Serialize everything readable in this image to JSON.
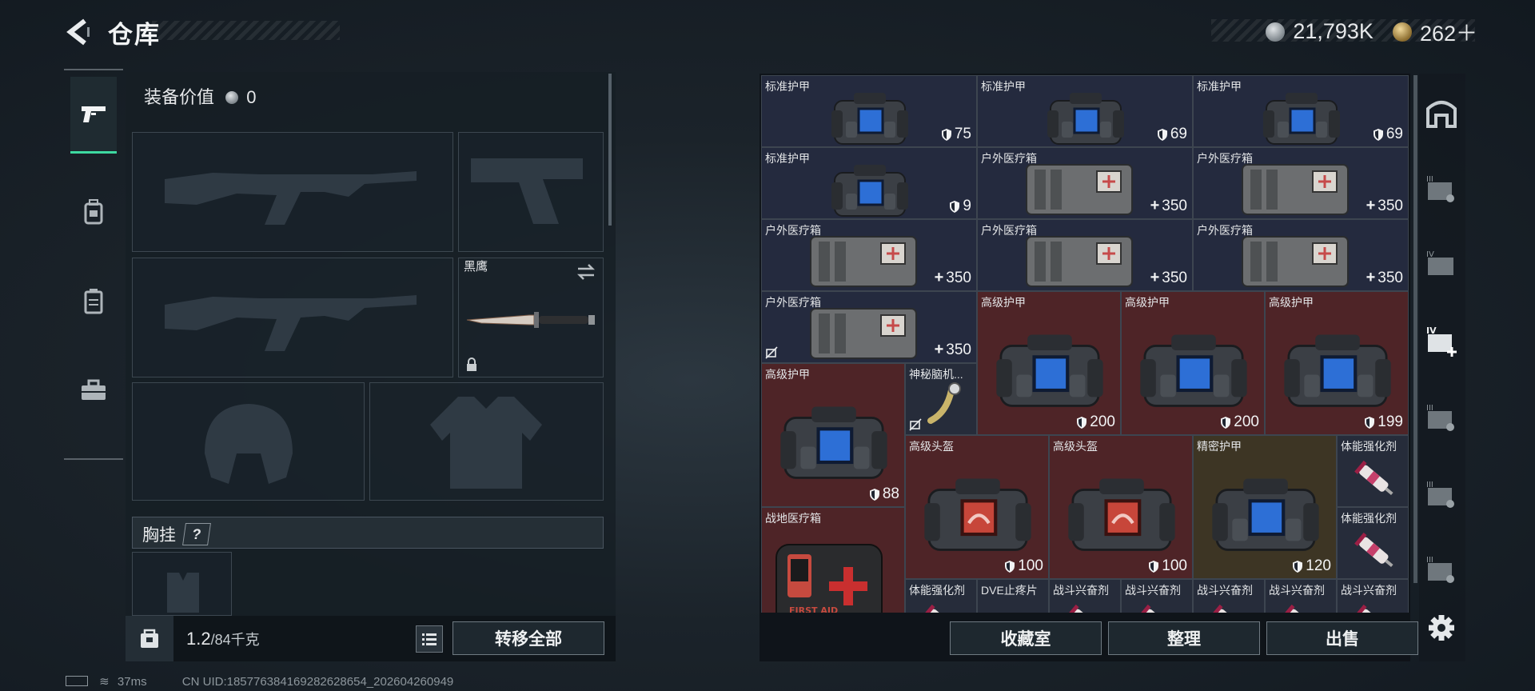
{
  "header": {
    "title": "仓库",
    "currency_silver": "21,793K",
    "currency_gold": "262＋"
  },
  "loadout": {
    "equip_value_label": "装备价值",
    "equip_value": "0",
    "knife_label": "黑鹰",
    "chest_label": "胸挂",
    "chest_help": "?",
    "weight_current": "1.2",
    "weight_max": "/84千克",
    "transfer_all": "转移全部"
  },
  "inventory": {
    "items": [
      {
        "name": "标准护甲",
        "value": "75",
        "kind": "shield"
      },
      {
        "name": "标准护甲",
        "value": "69",
        "kind": "shield"
      },
      {
        "name": "标准护甲",
        "value": "69",
        "kind": "shield"
      },
      {
        "name": "标准护甲",
        "value": "9",
        "kind": "shield"
      },
      {
        "name": "户外医疗箱",
        "value": "350",
        "kind": "heal"
      },
      {
        "name": "户外医疗箱",
        "value": "350",
        "kind": "heal"
      },
      {
        "name": "户外医疗箱",
        "value": "350",
        "kind": "heal"
      },
      {
        "name": "户外医疗箱",
        "value": "350",
        "kind": "heal"
      },
      {
        "name": "户外医疗箱",
        "value": "350",
        "kind": "heal"
      },
      {
        "name": "户外医疗箱",
        "value": "350",
        "kind": "heal"
      },
      {
        "name": "高级护甲",
        "value": "200",
        "kind": "shield"
      },
      {
        "name": "高级护甲",
        "value": "200",
        "kind": "shield"
      },
      {
        "name": "高级护甲",
        "value": "199",
        "kind": "shield"
      },
      {
        "name": "高级护甲",
        "value": "88",
        "kind": "shield"
      },
      {
        "name": "神秘脑机...",
        "value": "",
        "kind": "none"
      },
      {
        "name": "高级头盔",
        "value": "100",
        "kind": "shield"
      },
      {
        "name": "高级头盔",
        "value": "100",
        "kind": "shield"
      },
      {
        "name": "精密护甲",
        "value": "120",
        "kind": "shield"
      },
      {
        "name": "体能强化剂",
        "value": "",
        "kind": "none"
      },
      {
        "name": "体能强化剂",
        "value": "",
        "kind": "none"
      },
      {
        "name": "战地医疗箱",
        "value": "",
        "kind": "none"
      },
      {
        "name": "体能强化剂",
        "value": "",
        "kind": "none"
      },
      {
        "name": "DVE止疼片",
        "value": "",
        "kind": "none"
      },
      {
        "name": "战斗兴奋剂",
        "value": "",
        "kind": "none"
      },
      {
        "name": "战斗兴奋剂",
        "value": "",
        "kind": "none"
      },
      {
        "name": "战斗兴奋剂",
        "value": "",
        "kind": "none"
      },
      {
        "name": "战斗兴奋剂",
        "value": "",
        "kind": "none"
      },
      {
        "name": "战斗兴奋剂",
        "value": "",
        "kind": "none"
      }
    ],
    "first_aid_text": "FIRST AID"
  },
  "actions": {
    "collection": "收藏室",
    "organize": "整理",
    "sell": "出售"
  },
  "status": {
    "ping": "37ms",
    "uid": "CN UID:18577638416928262865​4_202604260949"
  },
  "colors": {
    "accent_active": "#3dd9a0",
    "cell_standard": "#242a3e",
    "cell_red": "#4e2427",
    "cell_gold": "#3d3524"
  },
  "icons": {
    "back": "back-arrow-icon",
    "tab1": "pistol-icon",
    "tab2": "backpack-icon",
    "tab3": "vest-icon",
    "tab4": "toolbox-icon",
    "settings": "gear-icon"
  }
}
